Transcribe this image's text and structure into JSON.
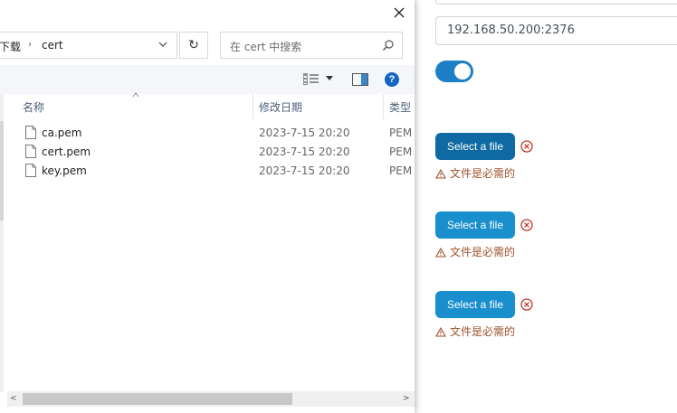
{
  "dialog": {
    "breadcrumb": [
      "下载",
      "cert"
    ],
    "search_placeholder": "在 cert 中搜索",
    "help_label": "?",
    "refresh_glyph": "↻",
    "columns": {
      "name": "名称",
      "date": "修改日期",
      "type": "类型"
    },
    "files": [
      {
        "name": "ca.pem",
        "date": "2023-7-15 20:20",
        "type": "PEM"
      },
      {
        "name": "cert.pem",
        "date": "2023-7-15 20:20",
        "type": "PEM"
      },
      {
        "name": "key.pem",
        "date": "2023-7-15 20:20",
        "type": "PEM"
      }
    ]
  },
  "form": {
    "host_value": "192.168.50.200:2376",
    "tls_enabled": true,
    "file_inputs": [
      {
        "button_label": "Select a file",
        "error": "文件是必需的"
      },
      {
        "button_label": "Select a file",
        "error": "文件是必需的"
      },
      {
        "button_label": "Select a file",
        "error": "文件是必需的"
      }
    ]
  },
  "colors": {
    "accent": "#1a8fcd",
    "accent_active": "#0f6aa3",
    "error_text": "#a0522d",
    "clear_icon": "#c0392b"
  }
}
